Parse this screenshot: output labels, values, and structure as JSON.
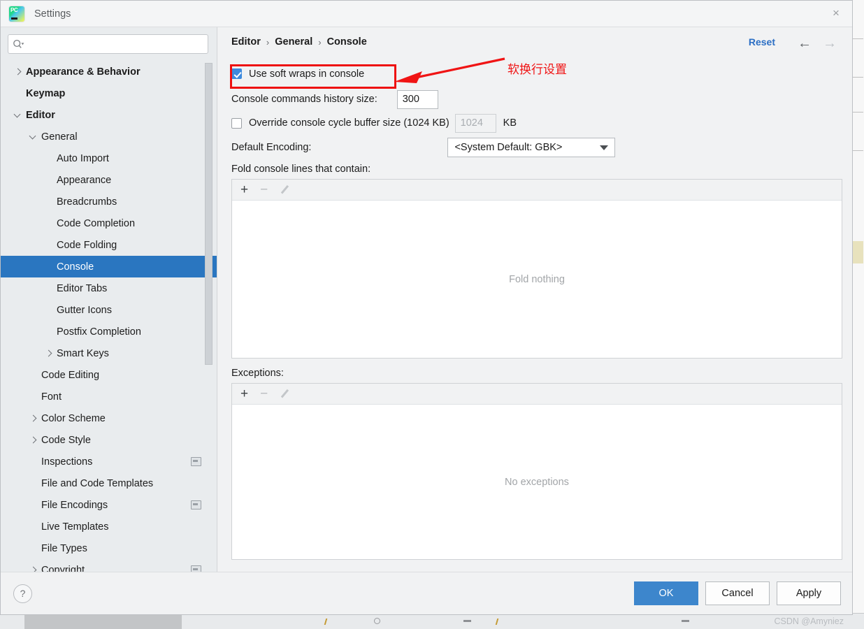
{
  "window": {
    "title": "Settings",
    "app_icon": "pycharm-icon",
    "close_label": "×"
  },
  "sidebar": {
    "search": {
      "value": "",
      "placeholder": "",
      "icon": "search-icon"
    },
    "items": [
      {
        "label": "Appearance & Behavior",
        "indent": 0,
        "chevron": "closed",
        "bold": true,
        "selected": false,
        "scope_icon": false
      },
      {
        "label": "Keymap",
        "indent": 0,
        "chevron": "none",
        "bold": true,
        "selected": false,
        "scope_icon": false
      },
      {
        "label": "Editor",
        "indent": 0,
        "chevron": "open",
        "bold": true,
        "selected": false,
        "scope_icon": false
      },
      {
        "label": "General",
        "indent": 1,
        "chevron": "open",
        "bold": false,
        "selected": false,
        "scope_icon": false
      },
      {
        "label": "Auto Import",
        "indent": 2,
        "chevron": "none",
        "bold": false,
        "selected": false,
        "scope_icon": false
      },
      {
        "label": "Appearance",
        "indent": 2,
        "chevron": "none",
        "bold": false,
        "selected": false,
        "scope_icon": false
      },
      {
        "label": "Breadcrumbs",
        "indent": 2,
        "chevron": "none",
        "bold": false,
        "selected": false,
        "scope_icon": false
      },
      {
        "label": "Code Completion",
        "indent": 2,
        "chevron": "none",
        "bold": false,
        "selected": false,
        "scope_icon": false
      },
      {
        "label": "Code Folding",
        "indent": 2,
        "chevron": "none",
        "bold": false,
        "selected": false,
        "scope_icon": false
      },
      {
        "label": "Console",
        "indent": 2,
        "chevron": "none",
        "bold": false,
        "selected": true,
        "scope_icon": false
      },
      {
        "label": "Editor Tabs",
        "indent": 2,
        "chevron": "none",
        "bold": false,
        "selected": false,
        "scope_icon": false
      },
      {
        "label": "Gutter Icons",
        "indent": 2,
        "chevron": "none",
        "bold": false,
        "selected": false,
        "scope_icon": false
      },
      {
        "label": "Postfix Completion",
        "indent": 2,
        "chevron": "none",
        "bold": false,
        "selected": false,
        "scope_icon": false
      },
      {
        "label": "Smart Keys",
        "indent": 2,
        "chevron": "closed",
        "bold": false,
        "selected": false,
        "scope_icon": false
      },
      {
        "label": "Code Editing",
        "indent": 1,
        "chevron": "none",
        "bold": false,
        "selected": false,
        "scope_icon": false
      },
      {
        "label": "Font",
        "indent": 1,
        "chevron": "none",
        "bold": false,
        "selected": false,
        "scope_icon": false
      },
      {
        "label": "Color Scheme",
        "indent": 1,
        "chevron": "closed",
        "bold": false,
        "selected": false,
        "scope_icon": false
      },
      {
        "label": "Code Style",
        "indent": 1,
        "chevron": "closed",
        "bold": false,
        "selected": false,
        "scope_icon": false
      },
      {
        "label": "Inspections",
        "indent": 1,
        "chevron": "none",
        "bold": false,
        "selected": false,
        "scope_icon": true
      },
      {
        "label": "File and Code Templates",
        "indent": 1,
        "chevron": "none",
        "bold": false,
        "selected": false,
        "scope_icon": false
      },
      {
        "label": "File Encodings",
        "indent": 1,
        "chevron": "none",
        "bold": false,
        "selected": false,
        "scope_icon": true
      },
      {
        "label": "Live Templates",
        "indent": 1,
        "chevron": "none",
        "bold": false,
        "selected": false,
        "scope_icon": false
      },
      {
        "label": "File Types",
        "indent": 1,
        "chevron": "none",
        "bold": false,
        "selected": false,
        "scope_icon": false
      },
      {
        "label": "Copyright",
        "indent": 1,
        "chevron": "closed",
        "bold": false,
        "selected": false,
        "scope_icon": true
      }
    ]
  },
  "main": {
    "breadcrumb": [
      "Editor",
      "General",
      "Console"
    ],
    "breadcrumb_separator": "›",
    "reset_label": "Reset",
    "nav_back_icon": "arrow-left-icon",
    "nav_forward_icon": "arrow-right-icon",
    "soft_wraps": {
      "label": "Use soft wraps in console",
      "checked": true
    },
    "history_size": {
      "label": "Console commands history size:",
      "value": "300"
    },
    "override_buffer": {
      "label": "Override console cycle buffer size (1024 KB)",
      "checked": false,
      "value": "1024",
      "unit": "KB"
    },
    "default_encoding": {
      "label": "Default Encoding:",
      "value": "<System Default: GBK>"
    },
    "fold_section": {
      "label": "Fold console lines that contain:",
      "empty_text": "Fold nothing",
      "toolbar": {
        "add": "+",
        "remove": "−",
        "edit": "pencil-icon"
      }
    },
    "exceptions_section": {
      "label": "Exceptions:",
      "empty_text": "No exceptions",
      "toolbar": {
        "add": "+",
        "remove": "−",
        "edit": "pencil-icon"
      }
    }
  },
  "annotation": {
    "text": "软换行设置",
    "color": "#f01414"
  },
  "footer": {
    "help_label": "?",
    "ok_label": "OK",
    "cancel_label": "Cancel",
    "apply_label": "Apply",
    "watermark": "CSDN @Amyniez"
  },
  "colors": {
    "accent": "#2a76c0",
    "checkbox": "#3d8ade",
    "primary_button": "#3d86cc",
    "link": "#2c6fc4",
    "annotation": "#ee1111"
  }
}
